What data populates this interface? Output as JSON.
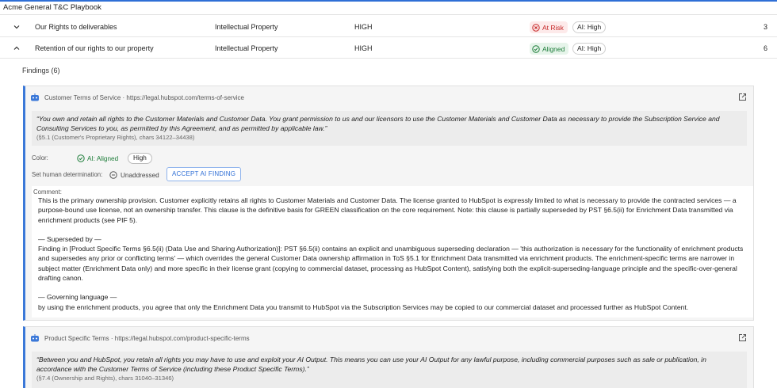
{
  "playbook": {
    "title": "Acme General T&C Playbook"
  },
  "rows": [
    {
      "name": "Our Rights to deliverables",
      "category": "Intellectual Property",
      "severity": "HIGH",
      "status": "At Risk",
      "ai": "AI: High",
      "count": "3",
      "expanded": false
    },
    {
      "name": "Retention of our rights to our property",
      "category": "Intellectual Property",
      "severity": "HIGH",
      "status": "Aligned",
      "ai": "AI: High",
      "count": "6",
      "expanded": true
    }
  ],
  "findings": {
    "label": "Findings (6)",
    "items": [
      {
        "source": "Customer Terms of Service · https://legal.hubspot.com/terms-of-service",
        "quote": "“You own and retain all rights to the Customer Materials and Customer Data. You grant permission to us and our licensors to use the Customer Materials and Customer Data as necessary to provide the Subscription Service and Consulting Services to you, as permitted by this Agreement, and as permitted by applicable law.”",
        "ref": "(§5.1 (Customer's Proprietary Rights), chars 34122–34438)",
        "color_label": "Color:",
        "ai_status": "AI: Aligned",
        "confidence": "High",
        "human_label": "Set human determination:",
        "human_status": "Unaddressed",
        "accept_label": "ACCEPT AI FINDING",
        "comment_label": "Comment:",
        "comment_p1": "This is the primary ownership provision. Customer explicitly retains all rights to Customer Materials and Customer Data. The license granted to HubSpot is expressly limited to what is necessary to provide the contracted services — a purpose-bound use license, not an ownership transfer. This clause is the definitive basis for GREEN classification on the core requirement. Note: this clause is partially superseded by PST §6.5(ii) for Enrichment Data transmitted via enrichment products (see PIF 5).",
        "comment_h2": "— Superseded by —",
        "comment_p2": "Finding in [Product Specific Terms §6.5(ii) (Data Use and Sharing Authorization)]: PST §6.5(ii) contains an explicit and unambiguous superseding declaration — 'this authorization is necessary for the functionality of enrichment products and supersedes any prior or conflicting terms' — which overrides the general Customer Data ownership affirmation in ToS §5.1 for Enrichment Data transmitted via enrichment products. The enrichment-specific terms are narrower in subject matter (Enrichment Data only) and more specific in their license grant (copying to commercial dataset, processing as HubSpot Content), satisfying both the explicit-superseding-language principle and the specific-over-general drafting canon.",
        "comment_h3": "— Governing language —",
        "comment_p3": "by using the enrichment products, you agree that only the Enrichment Data you transmit to HubSpot via the Subscription Services may be copied to our commercial dataset and processed further as HubSpot Content."
      },
      {
        "source": "Product Specific Terms · https://legal.hubspot.com/product-specific-terms",
        "quote": "“Between you and HubSpot, you retain all rights you may have to use and exploit your AI Output. This means you can use your AI Output for any lawful purpose, including commercial purposes such as sale or publication, in accordance with the Customer Terms of Service (including these Product Specific Terms).”",
        "ref": "(§7.4 (Ownership and Rights), chars 31040–31346)"
      }
    ]
  },
  "colors": {
    "accent": "#2f6fd6",
    "risk": "#c62828",
    "aligned": "#1e7d3a"
  }
}
